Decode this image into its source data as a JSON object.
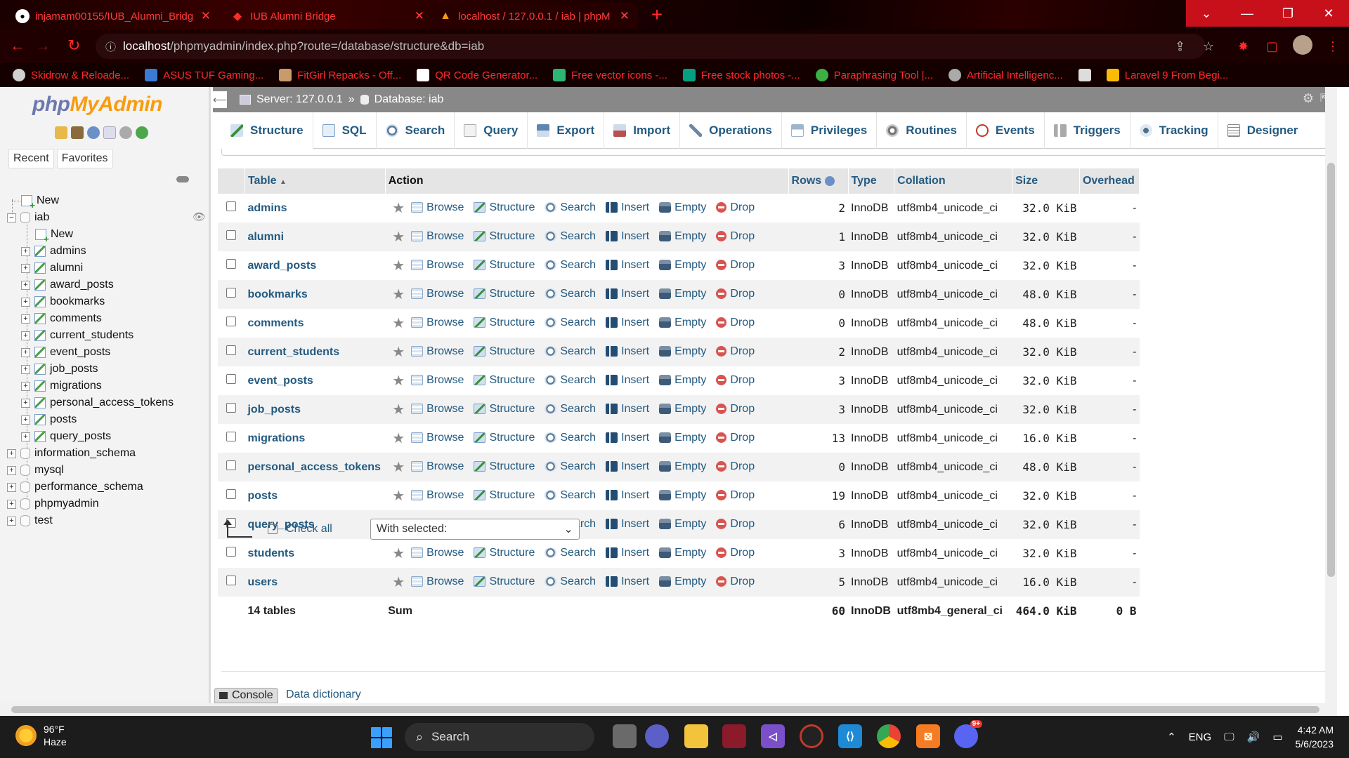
{
  "browser": {
    "tabs": [
      {
        "title": "injamam00155/IUB_Alumni_Bridg",
        "icon": "github-icon"
      },
      {
        "title": "IUB Alumni Bridge",
        "icon": "laravel-icon"
      },
      {
        "title": "localhost / 127.0.0.1 / iab | phpM",
        "icon": "phpmyadmin-icon"
      }
    ],
    "url_host": "localhost",
    "url_path": "/phpmyadmin/index.php?route=/database/structure&db=iab",
    "bookmarks": [
      {
        "label": "Skidrow & Reloade...",
        "color": "#d0d0d0"
      },
      {
        "label": "ASUS TUF Gaming...",
        "color": "#3a7bd5"
      },
      {
        "label": "FitGirl Repacks - Off...",
        "color": "#c99a6a"
      },
      {
        "label": "QR Code Generator...",
        "color": "#ffffff"
      },
      {
        "label": "Free vector icons -...",
        "color": "#2bb673"
      },
      {
        "label": "Free stock photos -...",
        "color": "#05a081"
      },
      {
        "label": "Paraphrasing Tool |...",
        "color": "#3cb043"
      },
      {
        "label": "Artificial Intelligenc...",
        "color": "#aaaaaa"
      },
      {
        "label": "",
        "color": "#dddddd"
      },
      {
        "label": "Laravel 9 From Begi...",
        "color": "#fbbc05"
      }
    ]
  },
  "nav": {
    "logo_php": "php",
    "logo_myadmin": "MyAdmin",
    "tabs": [
      "Recent",
      "Favorites"
    ],
    "tree": {
      "new_top": "New",
      "db": "iab",
      "new_table": "New",
      "tables": [
        "admins",
        "alumni",
        "award_posts",
        "bookmarks",
        "comments",
        "current_students",
        "event_posts",
        "job_posts",
        "migrations",
        "personal_access_tokens",
        "posts",
        "query_posts"
      ],
      "other_dbs": [
        "information_schema",
        "mysql",
        "performance_schema",
        "phpmyadmin",
        "test"
      ]
    }
  },
  "breadcrumb": {
    "server": "Server: 127.0.0.1",
    "sep": "»",
    "database": "Database: iab"
  },
  "main_tabs": [
    "Structure",
    "SQL",
    "Search",
    "Query",
    "Export",
    "Import",
    "Operations",
    "Privileges",
    "Routines",
    "Events",
    "Triggers",
    "Tracking",
    "Designer"
  ],
  "table": {
    "headers": {
      "table": "Table",
      "action": "Action",
      "rows": "Rows",
      "type": "Type",
      "collation": "Collation",
      "size": "Size",
      "overhead": "Overhead"
    },
    "actions": {
      "browse": "Browse",
      "structure": "Structure",
      "search": "Search",
      "insert": "Insert",
      "empty": "Empty",
      "drop": "Drop"
    },
    "rows": [
      {
        "name": "admins",
        "rows": "2",
        "type": "InnoDB",
        "collation": "utf8mb4_unicode_ci",
        "size": "32.0 KiB",
        "overhead": "-"
      },
      {
        "name": "alumni",
        "rows": "1",
        "type": "InnoDB",
        "collation": "utf8mb4_unicode_ci",
        "size": "32.0 KiB",
        "overhead": "-"
      },
      {
        "name": "award_posts",
        "rows": "3",
        "type": "InnoDB",
        "collation": "utf8mb4_unicode_ci",
        "size": "32.0 KiB",
        "overhead": "-"
      },
      {
        "name": "bookmarks",
        "rows": "0",
        "type": "InnoDB",
        "collation": "utf8mb4_unicode_ci",
        "size": "48.0 KiB",
        "overhead": "-"
      },
      {
        "name": "comments",
        "rows": "0",
        "type": "InnoDB",
        "collation": "utf8mb4_unicode_ci",
        "size": "48.0 KiB",
        "overhead": "-"
      },
      {
        "name": "current_students",
        "rows": "2",
        "type": "InnoDB",
        "collation": "utf8mb4_unicode_ci",
        "size": "32.0 KiB",
        "overhead": "-"
      },
      {
        "name": "event_posts",
        "rows": "3",
        "type": "InnoDB",
        "collation": "utf8mb4_unicode_ci",
        "size": "32.0 KiB",
        "overhead": "-"
      },
      {
        "name": "job_posts",
        "rows": "3",
        "type": "InnoDB",
        "collation": "utf8mb4_unicode_ci",
        "size": "32.0 KiB",
        "overhead": "-"
      },
      {
        "name": "migrations",
        "rows": "13",
        "type": "InnoDB",
        "collation": "utf8mb4_unicode_ci",
        "size": "16.0 KiB",
        "overhead": "-"
      },
      {
        "name": "personal_access_tokens",
        "rows": "0",
        "type": "InnoDB",
        "collation": "utf8mb4_unicode_ci",
        "size": "48.0 KiB",
        "overhead": "-"
      },
      {
        "name": "posts",
        "rows": "19",
        "type": "InnoDB",
        "collation": "utf8mb4_unicode_ci",
        "size": "32.0 KiB",
        "overhead": "-"
      },
      {
        "name": "query_posts",
        "rows": "6",
        "type": "InnoDB",
        "collation": "utf8mb4_unicode_ci",
        "size": "32.0 KiB",
        "overhead": "-"
      },
      {
        "name": "students",
        "rows": "3",
        "type": "InnoDB",
        "collation": "utf8mb4_unicode_ci",
        "size": "32.0 KiB",
        "overhead": "-"
      },
      {
        "name": "users",
        "rows": "5",
        "type": "InnoDB",
        "collation": "utf8mb4_unicode_ci",
        "size": "16.0 KiB",
        "overhead": "-"
      }
    ],
    "summary": {
      "label": "14 tables",
      "action": "Sum",
      "rows": "60",
      "type": "InnoDB",
      "collation": "utf8mb4_general_ci",
      "size": "464.0 KiB",
      "overhead": "0 B"
    }
  },
  "bulk": {
    "check_all": "Check all",
    "with_selected": "With selected:"
  },
  "footer": {
    "console": "Console",
    "data_dictionary": "Data dictionary"
  },
  "taskbar": {
    "temp": "96°F",
    "condition": "Haze",
    "search": "Search",
    "lang": "ENG",
    "time": "4:42 AM",
    "date": "5/6/2023",
    "discord_badge": "9+"
  },
  "colors": {
    "link": "#235a81",
    "browser_accent": "#ff2a2a",
    "window_controls": "#c8101a"
  }
}
